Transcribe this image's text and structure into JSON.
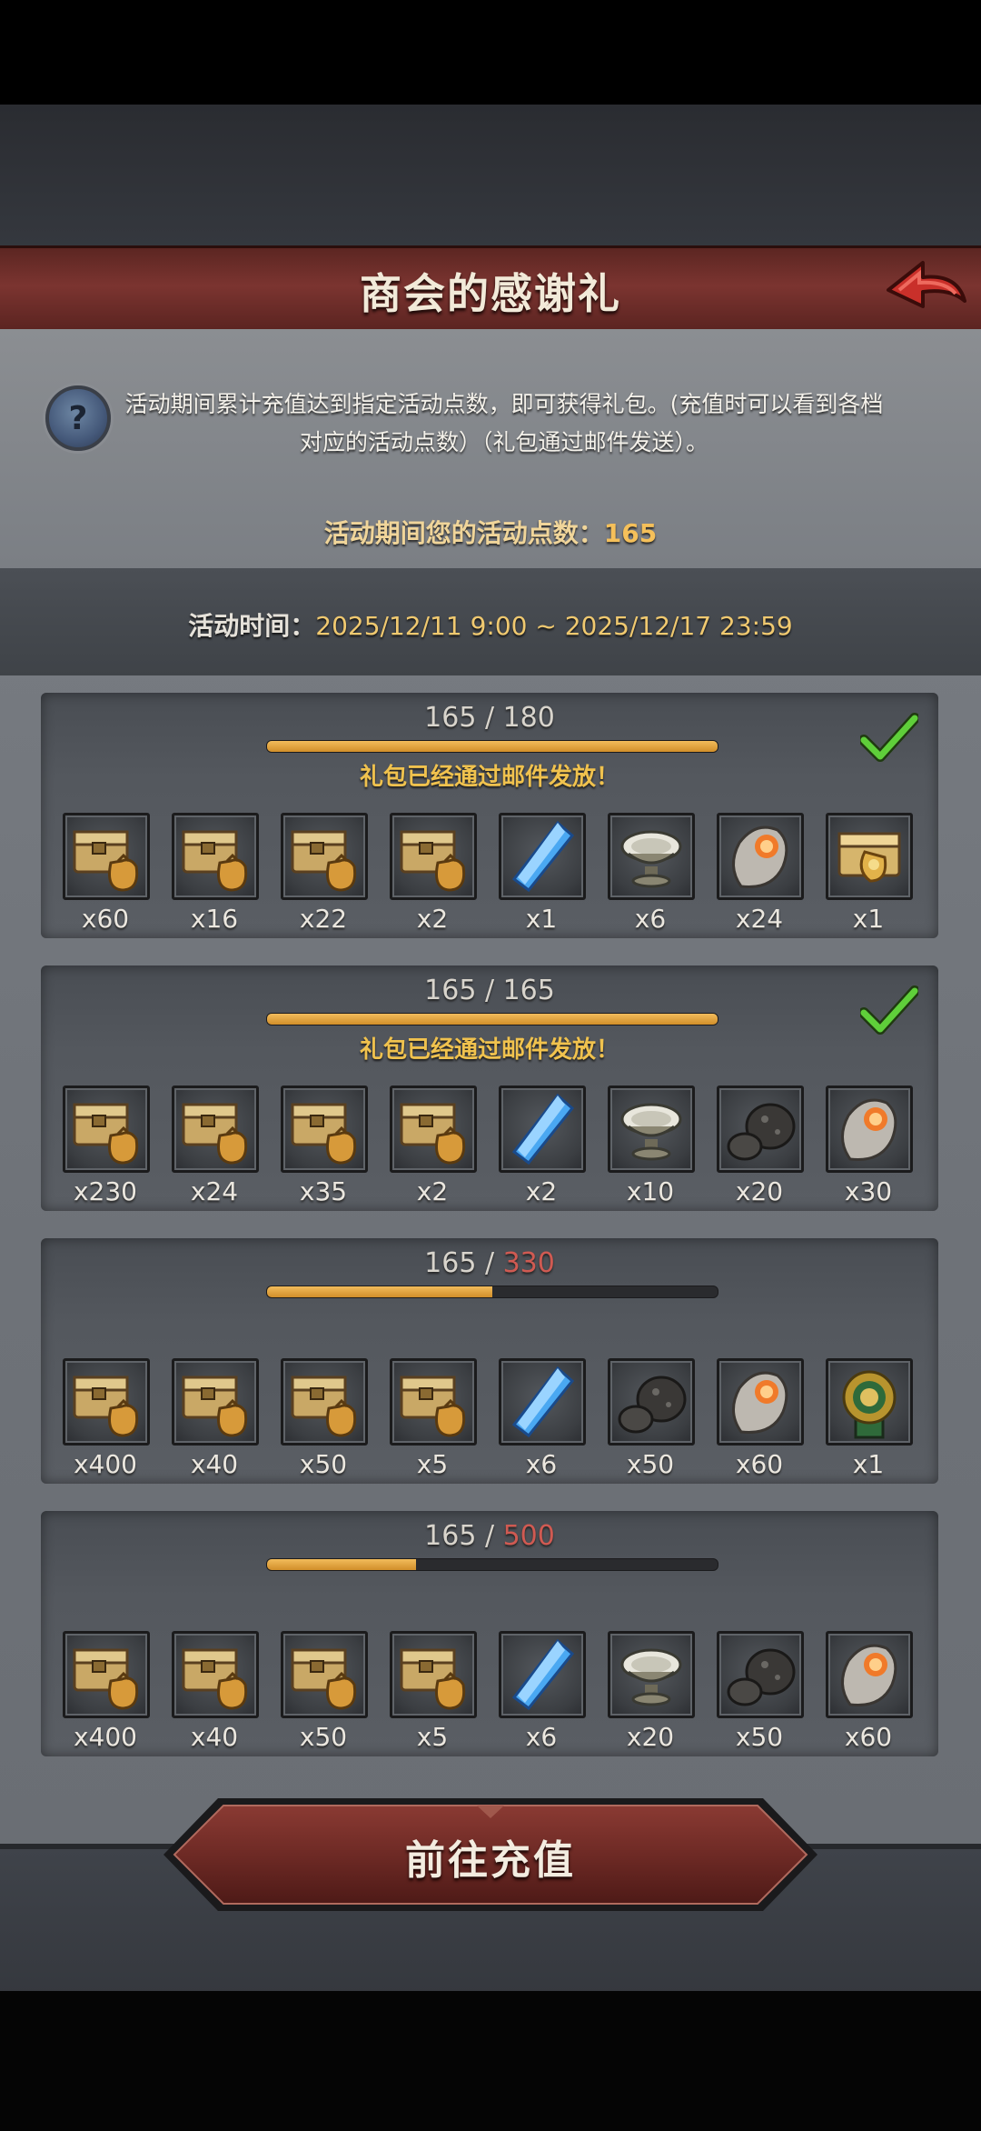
{
  "header": {
    "title": "商会的感谢礼"
  },
  "description": "活动期间累计充值达到指定活动点数，即可获得礼包。(充值时可以看到各档对应的活动点数）（礼包通过邮件发送）。",
  "points": {
    "label": "活动期间您的活动点数：",
    "value": "165"
  },
  "period": {
    "label": "活动时间：",
    "value": "2025/12/11 9:00 ~ 2025/12/17 23:59"
  },
  "tiers": [
    {
      "current": "165",
      "target": "180",
      "progress": 1.0,
      "claimed_text": "礼包已经通过邮件发放！",
      "completed": true,
      "items": [
        {
          "icon": "chest-bag-icon",
          "qty": "x60"
        },
        {
          "icon": "chest-bag-icon",
          "qty": "x16"
        },
        {
          "icon": "chest-bag-icon",
          "qty": "x22"
        },
        {
          "icon": "chest-bag-icon",
          "qty": "x2"
        },
        {
          "icon": "blue-crystal-icon",
          "qty": "x1"
        },
        {
          "icon": "silver-bowl-icon",
          "qty": "x6"
        },
        {
          "icon": "ore-stone-icon",
          "qty": "x24"
        },
        {
          "icon": "gold-chest-icon",
          "qty": "x1"
        }
      ]
    },
    {
      "current": "165",
      "target": "165",
      "progress": 1.0,
      "claimed_text": "礼包已经通过邮件发放！",
      "completed": true,
      "items": [
        {
          "icon": "chest-bag-icon",
          "qty": "x230"
        },
        {
          "icon": "chest-bag-icon",
          "qty": "x24"
        },
        {
          "icon": "chest-bag-icon",
          "qty": "x35"
        },
        {
          "icon": "chest-bag-icon",
          "qty": "x2"
        },
        {
          "icon": "blue-crystal-icon",
          "qty": "x2"
        },
        {
          "icon": "silver-bowl-icon",
          "qty": "x10"
        },
        {
          "icon": "dark-rock-icon",
          "qty": "x20"
        },
        {
          "icon": "ore-stone-icon",
          "qty": "x30"
        }
      ]
    },
    {
      "current": "165",
      "target": "330",
      "progress": 0.5,
      "claimed_text": "",
      "completed": false,
      "items": [
        {
          "icon": "chest-bag-icon",
          "qty": "x400"
        },
        {
          "icon": "chest-bag-icon",
          "qty": "x40"
        },
        {
          "icon": "chest-bag-icon",
          "qty": "x50"
        },
        {
          "icon": "chest-bag-icon",
          "qty": "x5"
        },
        {
          "icon": "blue-crystal-icon",
          "qty": "x6"
        },
        {
          "icon": "dark-rock-icon",
          "qty": "x50"
        },
        {
          "icon": "ore-stone-icon",
          "qty": "x60"
        },
        {
          "icon": "lion-medal-icon",
          "qty": "x1"
        }
      ]
    },
    {
      "current": "165",
      "target": "500",
      "progress": 0.33,
      "claimed_text": "",
      "completed": false,
      "items": [
        {
          "icon": "chest-bag-icon",
          "qty": "x400"
        },
        {
          "icon": "chest-bag-icon",
          "qty": "x40"
        },
        {
          "icon": "chest-bag-icon",
          "qty": "x50"
        },
        {
          "icon": "chest-bag-icon",
          "qty": "x5"
        },
        {
          "icon": "blue-crystal-icon",
          "qty": "x6"
        },
        {
          "icon": "silver-bowl-icon",
          "qty": "x20"
        },
        {
          "icon": "dark-rock-icon",
          "qty": "x50"
        },
        {
          "icon": "ore-stone-icon",
          "qty": "x60"
        }
      ]
    }
  ],
  "footer": {
    "button_label": "前往充值"
  },
  "colors": {
    "banner": "#7b3430",
    "progress": "#f2bc5b",
    "claimed": "#f0c24e",
    "target_unmet": "#d05a52",
    "check": "#5fcf3a"
  }
}
